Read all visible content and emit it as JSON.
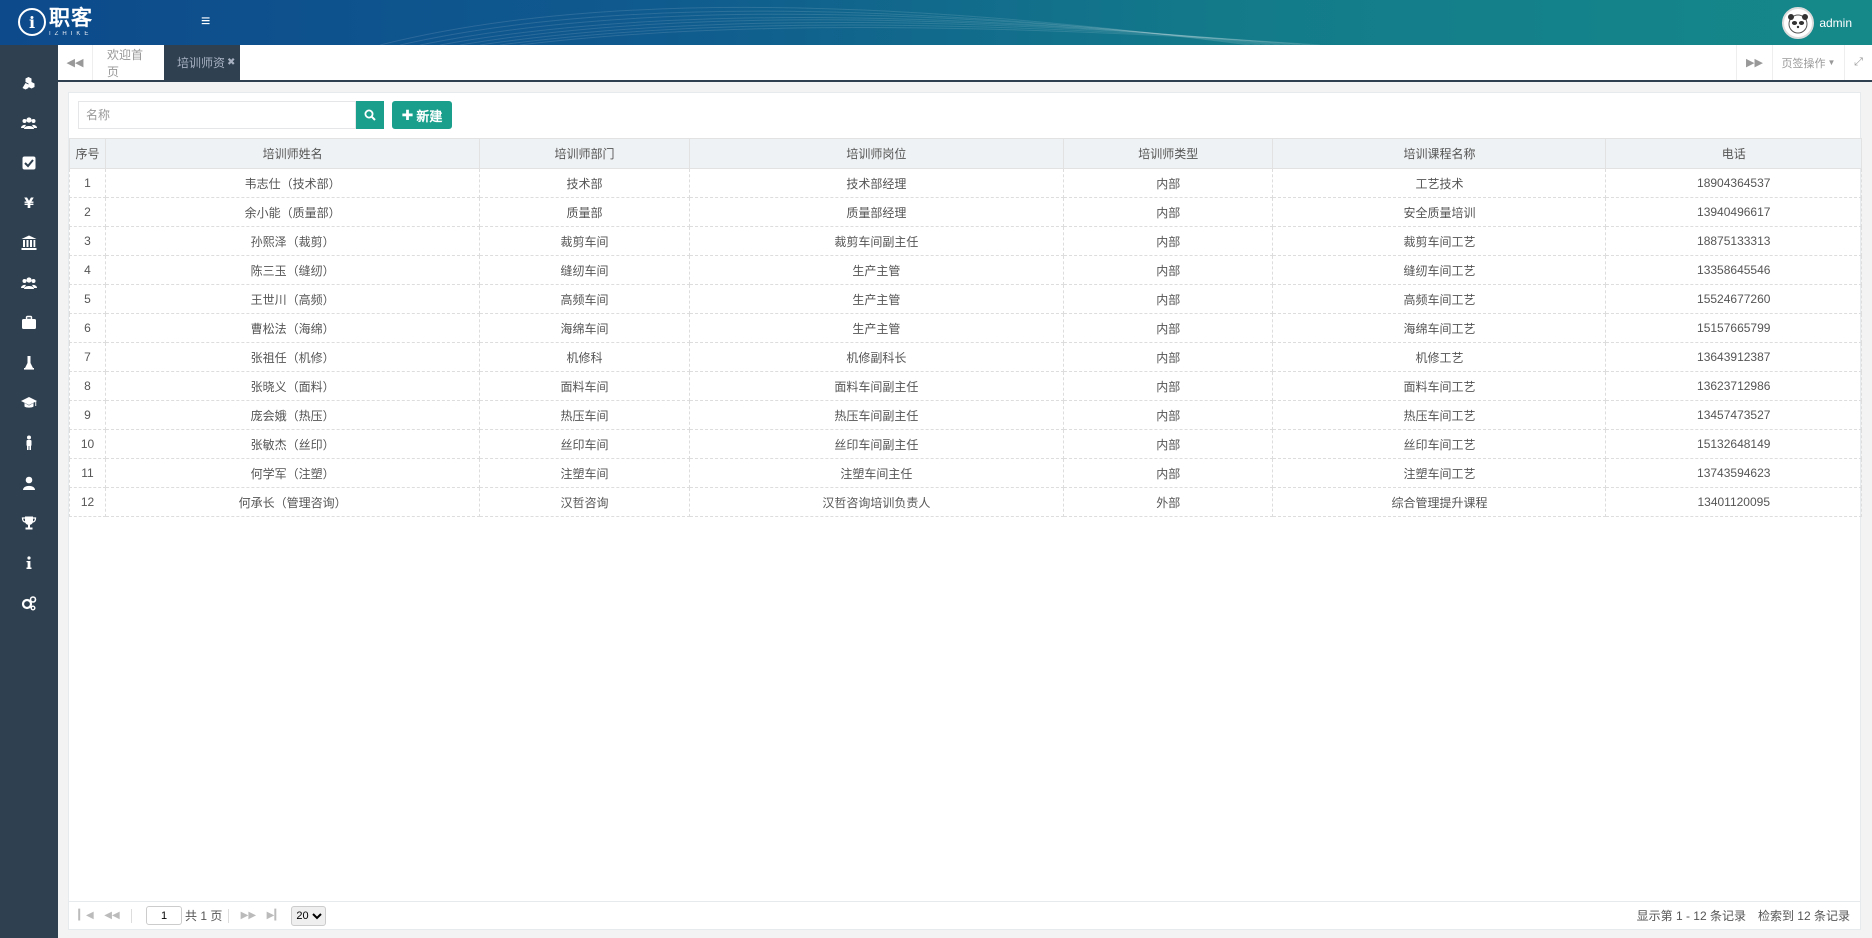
{
  "app": {
    "logo_main": "职客",
    "logo_sub": "IZHIKE",
    "logo_mark": "i",
    "username": "admin"
  },
  "colors": {
    "header": "#0f5a8e",
    "sidebar": "#2f4050",
    "accent": "#1a9f8c"
  },
  "sidebar": {
    "icons": [
      "cubes-icon",
      "users-icon",
      "check-square-icon",
      "yen-icon",
      "bank-icon",
      "group-icon",
      "briefcase-icon",
      "flask-icon",
      "graduation-cap-icon",
      "male-icon",
      "user-icon",
      "trophy-icon",
      "info-icon",
      "gears-icon"
    ]
  },
  "tabs": {
    "home_label": "欢迎首页",
    "active_label": "培训师资",
    "close_glyph": "✖",
    "ops_label": "页签操作"
  },
  "search": {
    "placeholder": "名称"
  },
  "toolbar": {
    "new_label": "新建"
  },
  "table": {
    "headers": [
      "序号",
      "培训师姓名",
      "培训师部门",
      "培训师岗位",
      "培训师类型",
      "培训课程名称",
      "电话"
    ],
    "rows": [
      [
        "1",
        "韦志仕（技术部）",
        "技术部",
        "技术部经理",
        "内部",
        "工艺技术",
        "18904364537"
      ],
      [
        "2",
        "余小能（质量部）",
        "质量部",
        "质量部经理",
        "内部",
        "安全质量培训",
        "13940496617"
      ],
      [
        "3",
        "孙熙泽（裁剪）",
        "裁剪车间",
        "裁剪车间副主任",
        "内部",
        "裁剪车间工艺",
        "18875133313"
      ],
      [
        "4",
        "陈三玉（缝纫）",
        "缝纫车间",
        "生产主管",
        "内部",
        "缝纫车间工艺",
        "13358645546"
      ],
      [
        "5",
        "王世川（高频）",
        "高频车间",
        "生产主管",
        "内部",
        "高频车间工艺",
        "15524677260"
      ],
      [
        "6",
        "曹松法（海绵）",
        "海绵车间",
        "生产主管",
        "内部",
        "海绵车间工艺",
        "15157665799"
      ],
      [
        "7",
        "张祖任（机修）",
        "机修科",
        "机修副科长",
        "内部",
        "机修工艺",
        "13643912387"
      ],
      [
        "8",
        "张晓义（面料）",
        "面料车间",
        "面料车间副主任",
        "内部",
        "面料车间工艺",
        "13623712986"
      ],
      [
        "9",
        "庞会娥（热压）",
        "热压车间",
        "热压车间副主任",
        "内部",
        "热压车间工艺",
        "13457473527"
      ],
      [
        "10",
        "张敏杰（丝印）",
        "丝印车间",
        "丝印车间副主任",
        "内部",
        "丝印车间工艺",
        "15132648149"
      ],
      [
        "11",
        "何学军（注塑）",
        "注塑车间",
        "注塑车间主任",
        "内部",
        "注塑车间工艺",
        "13743594623"
      ],
      [
        "12",
        "何承长（管理咨询）",
        "汉哲咨询",
        "汉哲咨询培训负责人",
        "外部",
        "综合管理提升课程",
        "13401120095"
      ]
    ]
  },
  "pager": {
    "current_page": "1",
    "total_pages_label": "共 1 页",
    "page_size": "20",
    "display_info": "显示第 1 - 12 条记录",
    "search_info": "检索到 12 条记录"
  }
}
